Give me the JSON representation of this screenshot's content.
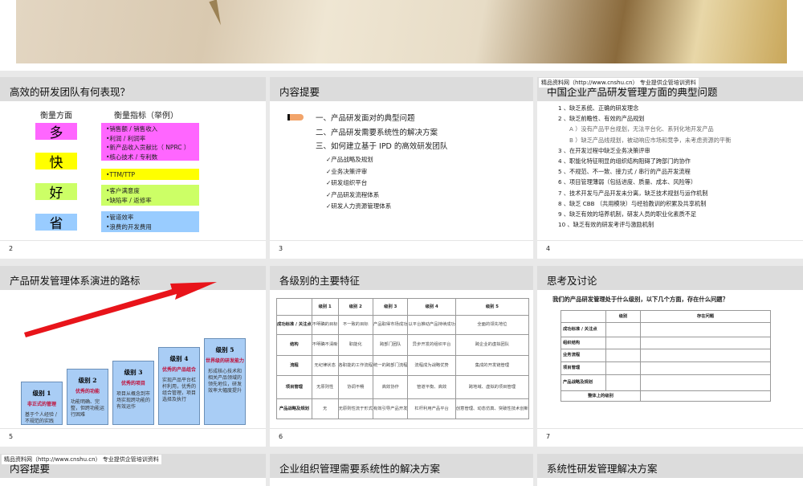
{
  "slide1": {},
  "slide2": {
    "title": "高效的研发团队有何表现？",
    "col1": "衡量方面",
    "col2": "衡量指标（举例）",
    "rows": [
      {
        "aspect": "多",
        "color": "#ff66ff",
        "items": [
          "•销售额 / 销售收入",
          "•利润 / 利润率",
          "•新产品收入贡献比（ NPRC ）",
          "•核心技术 / 专利数"
        ]
      },
      {
        "aspect": "快",
        "color": "#ffff00",
        "items": [
          "•TTM/TTP"
        ]
      },
      {
        "aspect": "好",
        "color": "#ccff66",
        "items": [
          "•客户满意度",
          "•缺陷率 / 返修率"
        ]
      },
      {
        "aspect": "省",
        "color": "#99ccff",
        "items": [
          "•管道效率",
          "•浪费的开发费用"
        ]
      }
    ],
    "page": "2"
  },
  "slide3": {
    "title": "内容提要",
    "items": [
      "一、产品研发面对的典型问题",
      "二、产品研发需要系统性的解决方案",
      "三、如何建立基于 IPD 的高效研发团队"
    ],
    "subitems": [
      "✓产品战略及规划",
      "✓业务决策评审",
      "✓研发组织平台",
      "✓产品研发流程体系",
      "✓研发人力资源管理体系"
    ],
    "page": "3"
  },
  "slide4": {
    "watermark": "精品资料网（http://www.cnshu.cn） 专业提供企管培训资料",
    "title": "中国企业产品研发管理方面的典型问题",
    "items": [
      "1 、缺乏系统、正确的研发理念",
      "2 、缺乏前瞻性、有效的产品规划",
      "A ）没有产品平台规划，无法平台化、系列化地开发产品",
      "B ）缺乏产品线规划，被动响应市场和竞争，未考虑资源的平衡",
      "3 、在开发过程中缺乏业务决策评审",
      "4 、职能化特征明显的组织结构阻碍了跨部门的协作",
      "5 、不规范、不一致、接力式 / 串行的产品开发流程",
      "6 、项目管理薄弱（包括进度、质量、成本、风险等）",
      "7 、技术开发与产品开发未分离，缺乏技术规划与运作机制",
      "8 、缺乏 CBB （共用模块）与经验教训的积累及共享机制",
      "9 、缺乏有效的培养机制，研发人员的职业化素质不足",
      "10 、缺乏有效的研发考评与激励机制"
    ],
    "page": "4"
  },
  "slide5": {
    "title": "产品研发管理体系演进的路标",
    "levels": [
      {
        "name": "级别 1",
        "tag": "非正式的管理",
        "desc": "基于个人经验 / 不规范的实践"
      },
      {
        "name": "级别 2",
        "tag": "优秀的功能",
        "desc": "功能明确、完整，但跨功能运行困难"
      },
      {
        "name": "级别 3",
        "tag": "优秀的项目",
        "desc": "项目从概念到市场实现跨功能的有效运作"
      },
      {
        "name": "级别 4",
        "tag": "优秀的产品组合",
        "desc": "实现产品平台杠杆利用，优秀的组合管理，项目选择及执行"
      },
      {
        "name": "级别 5",
        "tag": "世界级的研发能力",
        "desc": "形成核心技术和相关产品领域的领先地位，研发效率大幅度提升"
      }
    ],
    "page": "5"
  },
  "slide6": {
    "title": "各级别的主要特征",
    "header": [
      "",
      "级别 1",
      "级别 2",
      "级别 3",
      "级别 4",
      "级别 5"
    ],
    "rows": [
      [
        "成功标准 / 关注点",
        "不明确的目标",
        "不一致的目标",
        "产品取得市场成功",
        "以平台推动产品持续成功",
        "全面的领先地位"
      ],
      [
        "结构",
        "不明确不清晰",
        "职能化",
        "跨部门团队",
        "异步开发的组织平台",
        "跨企业的虚拟团队"
      ],
      [
        "流程",
        "无纪律状态",
        "各职能的工作流程",
        "统一的跨部门流程",
        "流程成为战略优势",
        "集成的开发链管理"
      ],
      [
        "项目管理",
        "无原则性",
        "协调不畅",
        "高效协作",
        "管道平衡、高效",
        "跨地域、虚拟的项目管理"
      ],
      [
        "产品战略及规划",
        "无",
        "无原则性流于形式",
        "有效引导产品开发",
        "杠杆利用产品平台",
        "创意管理、动态仿真、突破性技术创新"
      ]
    ],
    "page": "6"
  },
  "slide7": {
    "title": "思考及讨论",
    "question": "我们的产品研发管理处于什么级别，以下几个方面，存在什么问题？",
    "header": [
      "",
      "级别",
      "存在问题"
    ],
    "rows": [
      "成功标准 / 关注点",
      "组织结构",
      "业务流程",
      "项目管理",
      "产品战略及规划"
    ],
    "overall": "整体上的级别",
    "page": "7"
  },
  "slide8": {
    "watermark": "精品资料网（http://www.cnshu.cn） 专业提供企管培训资料",
    "title": "内容提要"
  },
  "slide9": {
    "title": "企业组织管理需要系统性的解决方案"
  },
  "slide10": {
    "title": "系统性研发管理解决方案"
  }
}
